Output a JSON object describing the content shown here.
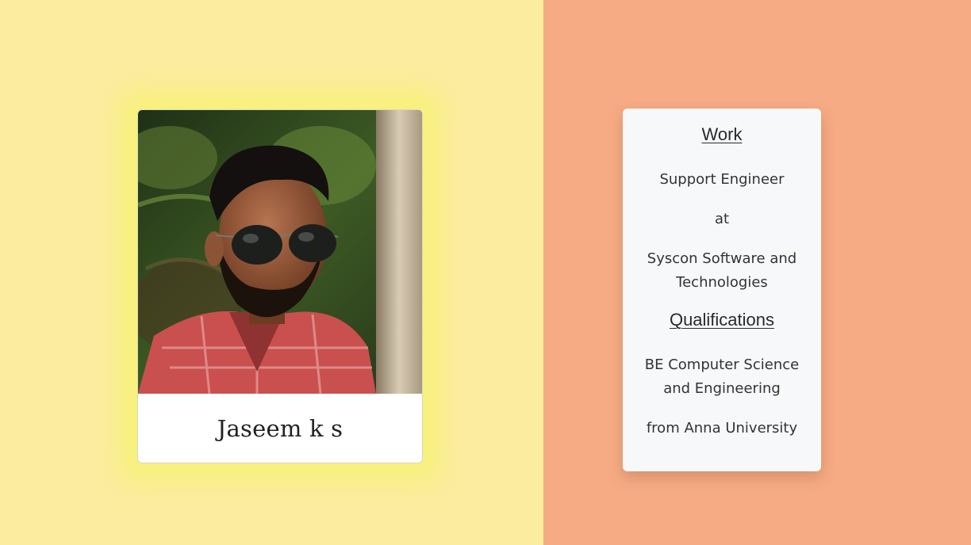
{
  "profile": {
    "name": "Jaseem k s"
  },
  "work": {
    "heading": "Work",
    "role": "Support Engineer",
    "connector": "at",
    "company": "Syscon Software and Technologies"
  },
  "qualifications": {
    "heading": "Qualifications",
    "degree": "BE Computer Science and Engineering",
    "institution": "from Anna University"
  },
  "colors": {
    "left_background": "#fcec9f",
    "right_background": "#f6ab84",
    "card_glow": "#f6f36e",
    "info_card_background": "#f7f8fa"
  }
}
